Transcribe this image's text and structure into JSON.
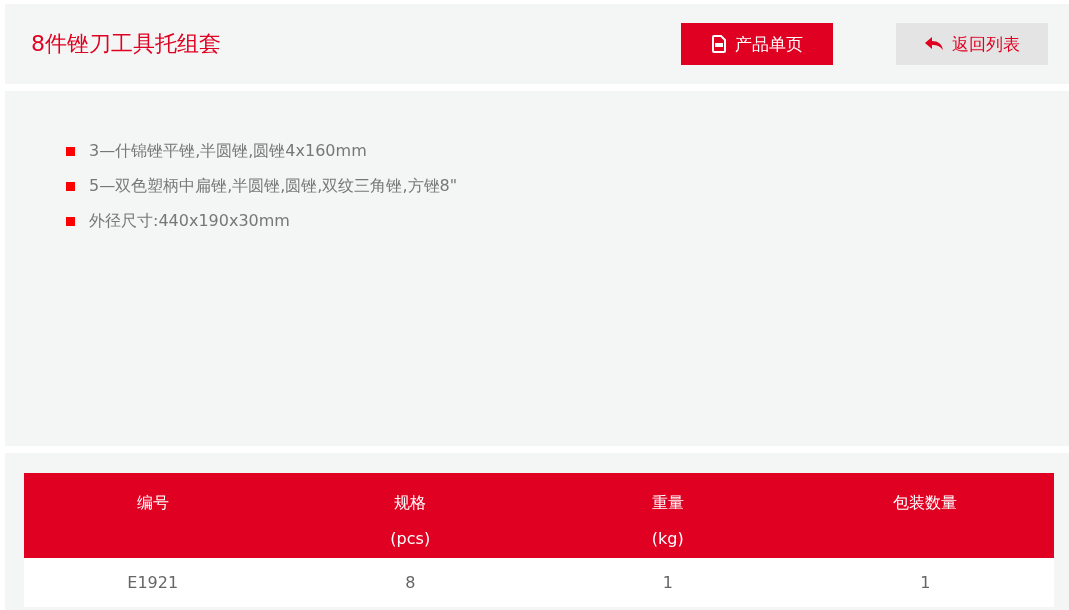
{
  "title": "8件锉刀工具托组套",
  "buttons": [
    {
      "kind": "primary",
      "label": "产品单页"
    },
    {
      "kind": "back",
      "label": "返回列表"
    }
  ],
  "features": [
    "3—什锦锉平锉,半圆锉,圆锉4x160mm",
    "5—双色塑柄中扁锉,半圆锉,圆锉,双纹三角锉,方锉8\"",
    "外径尺寸:440x190x30mm"
  ],
  "table": {
    "columns": [
      {
        "label": "编号"
      },
      {
        "label": "规格",
        "unit": "(pcs)"
      },
      {
        "label": "重量",
        "unit": "(kg)"
      },
      {
        "label": "包装数量"
      }
    ],
    "rows": [
      [
        "E1921",
        "8",
        "1",
        "1"
      ]
    ]
  }
}
